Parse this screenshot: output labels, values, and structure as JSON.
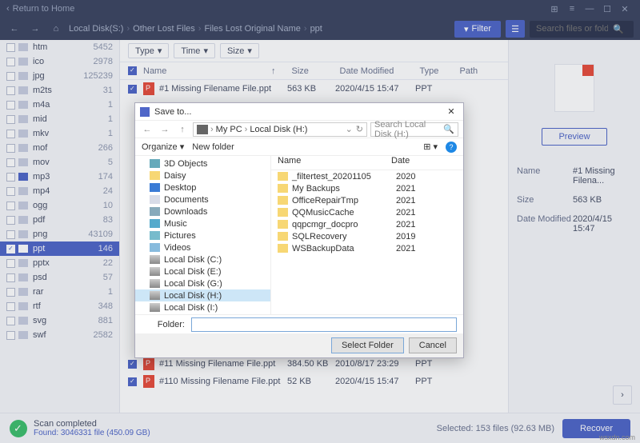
{
  "titlebar": {
    "return": "Return to Home"
  },
  "breadcrumb": [
    "Local Disk(S:)",
    "Other Lost Files",
    "Files Lost Original Name",
    "ppt"
  ],
  "filter_btn": "Filter",
  "search_placeholder": "Search files or folders",
  "filters": {
    "type": "Type",
    "time": "Time",
    "size": "Size"
  },
  "columns": {
    "name": "Name",
    "size": "Size",
    "date": "Date Modified",
    "type": "Type",
    "path": "Path"
  },
  "sidebar": [
    {
      "name": "htm",
      "count": "5452",
      "checked": false
    },
    {
      "name": "ico",
      "count": "2978",
      "checked": false
    },
    {
      "name": "jpg",
      "count": "125239",
      "checked": false
    },
    {
      "name": "m2ts",
      "count": "31",
      "checked": false
    },
    {
      "name": "m4a",
      "count": "1",
      "checked": false
    },
    {
      "name": "mid",
      "count": "1",
      "checked": false
    },
    {
      "name": "mkv",
      "count": "1",
      "checked": false
    },
    {
      "name": "mof",
      "count": "266",
      "checked": false
    },
    {
      "name": "mov",
      "count": "5",
      "checked": false
    },
    {
      "name": "mp3",
      "count": "174",
      "checked": false,
      "highlight": true
    },
    {
      "name": "mp4",
      "count": "24",
      "checked": false
    },
    {
      "name": "ogg",
      "count": "10",
      "checked": false
    },
    {
      "name": "pdf",
      "count": "83",
      "checked": false
    },
    {
      "name": "png",
      "count": "43109",
      "checked": false
    },
    {
      "name": "ppt",
      "count": "146",
      "checked": true,
      "selected": true
    },
    {
      "name": "pptx",
      "count": "22",
      "checked": false
    },
    {
      "name": "psd",
      "count": "57",
      "checked": false
    },
    {
      "name": "rar",
      "count": "1",
      "checked": false
    },
    {
      "name": "rtf",
      "count": "348",
      "checked": false
    },
    {
      "name": "svg",
      "count": "881",
      "checked": false
    },
    {
      "name": "swf",
      "count": "2582",
      "checked": false
    }
  ],
  "rows": [
    {
      "name": "#1 Missing Filename File.ppt",
      "size": "563 KB",
      "date": "2020/4/15 15:47",
      "type": "PPT"
    },
    {
      "name": "#11 Missing Filename File.ppt",
      "size": "384.50 KB",
      "date": "2010/8/17 23:29",
      "type": "PPT"
    },
    {
      "name": "#110 Missing Filename File.ppt",
      "size": "52 KB",
      "date": "2020/4/15 15:47",
      "type": "PPT"
    }
  ],
  "preview_btn": "Preview",
  "meta": {
    "name_k": "Name",
    "name_v": "#1 Missing Filena...",
    "size_k": "Size",
    "size_v": "563 KB",
    "date_k": "Date Modified",
    "date_v": "2020/4/15 15:47"
  },
  "footer": {
    "title": "Scan completed",
    "sub": "Found: 3046331 file (450.09 GB)",
    "selected": "Selected: 153 files (92.63 MB)",
    "recover": "Recover"
  },
  "dialog": {
    "title": "Save to...",
    "path": [
      "My PC",
      "Local Disk (H:)"
    ],
    "search_ph": "Search Local Disk (H:)",
    "organize": "Organize",
    "newfolder": "New folder",
    "tree": [
      {
        "label": "3D Objects",
        "ico": "ico-3d"
      },
      {
        "label": "Daisy",
        "ico": "ico-folder"
      },
      {
        "label": "Desktop",
        "ico": "ico-desktop"
      },
      {
        "label": "Documents",
        "ico": "ico-docs"
      },
      {
        "label": "Downloads",
        "ico": "ico-down"
      },
      {
        "label": "Music",
        "ico": "ico-music"
      },
      {
        "label": "Pictures",
        "ico": "ico-pics"
      },
      {
        "label": "Videos",
        "ico": "ico-vids"
      },
      {
        "label": "Local Disk (C:)",
        "ico": "ico-disk"
      },
      {
        "label": "Local Disk (E:)",
        "ico": "ico-disk"
      },
      {
        "label": "Local Disk (G:)",
        "ico": "ico-disk"
      },
      {
        "label": "Local Disk (H:)",
        "ico": "ico-disk",
        "selected": true
      },
      {
        "label": "Local Disk (I:)",
        "ico": "ico-disk"
      }
    ],
    "list_head": {
      "name": "Name",
      "date": "Date"
    },
    "list": [
      {
        "n": "_filtertest_20201105",
        "d": "2020"
      },
      {
        "n": "My Backups",
        "d": "2021"
      },
      {
        "n": "OfficeRepairTmp",
        "d": "2021"
      },
      {
        "n": "QQMusicCache",
        "d": "2021"
      },
      {
        "n": "qqpcmgr_docpro",
        "d": "2021"
      },
      {
        "n": "SQLRecovery",
        "d": "2019"
      },
      {
        "n": "WSBackupData",
        "d": "2021"
      }
    ],
    "folder_label": "Folder:",
    "select": "Select Folder",
    "cancel": "Cancel"
  },
  "watermark": "wsxdn.com"
}
